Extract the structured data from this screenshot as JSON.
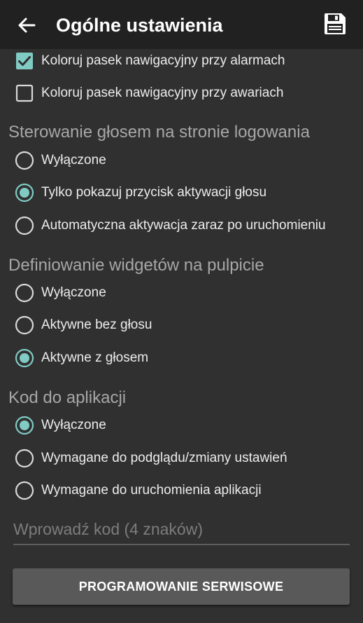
{
  "appbar": {
    "title": "Ogólne ustawienia",
    "back_icon": "arrow-back-icon",
    "save_icon": "floppy-disk-icon"
  },
  "colors": {
    "accent": "#80cbc4",
    "background": "#303030",
    "appbar": "#212121"
  },
  "nav_color": {
    "items": [
      {
        "label": "Koloruj pasek nawigacyjny przy alarmach",
        "checked": true
      },
      {
        "label": "Koloruj pasek nawigacyjny przy awariach",
        "checked": false
      }
    ]
  },
  "voice_login": {
    "title": "Sterowanie głosem na stronie logowania",
    "options": [
      {
        "label": "Wyłączone",
        "selected": false
      },
      {
        "label": "Tylko pokazuj przycisk aktywacji głosu",
        "selected": true
      },
      {
        "label": "Automatyczna aktywacja zaraz po uruchomieniu",
        "selected": false
      }
    ]
  },
  "widgets": {
    "title": "Definiowanie widgetów na pulpicie",
    "options": [
      {
        "label": "Wyłączone",
        "selected": false
      },
      {
        "label": "Aktywne bez głosu",
        "selected": false
      },
      {
        "label": "Aktywne z głosem",
        "selected": true
      }
    ]
  },
  "app_code": {
    "title": "Kod do aplikacji",
    "options": [
      {
        "label": "Wyłączone",
        "selected": true
      },
      {
        "label": "Wymagane do podglądu/zmiany ustawień",
        "selected": false
      },
      {
        "label": "Wymagane do uruchomienia aplikacji",
        "selected": false
      }
    ],
    "input_placeholder": "Wprowadź kod (4 znaków)",
    "input_value": ""
  },
  "service_button": {
    "label": "PROGRAMOWANIE SERWISOWE"
  }
}
